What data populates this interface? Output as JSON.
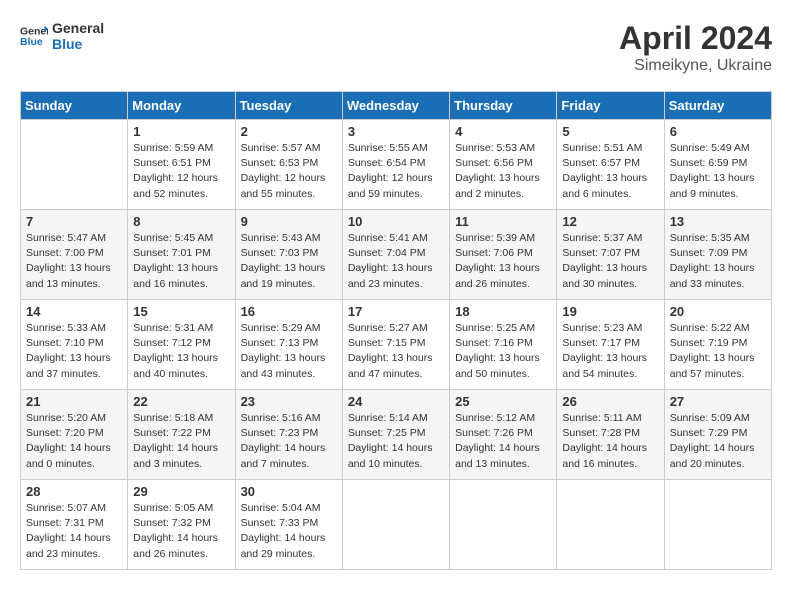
{
  "header": {
    "logo_general": "General",
    "logo_blue": "Blue",
    "month_title": "April 2024",
    "location": "Simeikyne, Ukraine"
  },
  "days_of_week": [
    "Sunday",
    "Monday",
    "Tuesday",
    "Wednesday",
    "Thursday",
    "Friday",
    "Saturday"
  ],
  "weeks": [
    [
      {
        "day": "",
        "info": ""
      },
      {
        "day": "1",
        "info": "Sunrise: 5:59 AM\nSunset: 6:51 PM\nDaylight: 12 hours\nand 52 minutes."
      },
      {
        "day": "2",
        "info": "Sunrise: 5:57 AM\nSunset: 6:53 PM\nDaylight: 12 hours\nand 55 minutes."
      },
      {
        "day": "3",
        "info": "Sunrise: 5:55 AM\nSunset: 6:54 PM\nDaylight: 12 hours\nand 59 minutes."
      },
      {
        "day": "4",
        "info": "Sunrise: 5:53 AM\nSunset: 6:56 PM\nDaylight: 13 hours\nand 2 minutes."
      },
      {
        "day": "5",
        "info": "Sunrise: 5:51 AM\nSunset: 6:57 PM\nDaylight: 13 hours\nand 6 minutes."
      },
      {
        "day": "6",
        "info": "Sunrise: 5:49 AM\nSunset: 6:59 PM\nDaylight: 13 hours\nand 9 minutes."
      }
    ],
    [
      {
        "day": "7",
        "info": "Sunrise: 5:47 AM\nSunset: 7:00 PM\nDaylight: 13 hours\nand 13 minutes."
      },
      {
        "day": "8",
        "info": "Sunrise: 5:45 AM\nSunset: 7:01 PM\nDaylight: 13 hours\nand 16 minutes."
      },
      {
        "day": "9",
        "info": "Sunrise: 5:43 AM\nSunset: 7:03 PM\nDaylight: 13 hours\nand 19 minutes."
      },
      {
        "day": "10",
        "info": "Sunrise: 5:41 AM\nSunset: 7:04 PM\nDaylight: 13 hours\nand 23 minutes."
      },
      {
        "day": "11",
        "info": "Sunrise: 5:39 AM\nSunset: 7:06 PM\nDaylight: 13 hours\nand 26 minutes."
      },
      {
        "day": "12",
        "info": "Sunrise: 5:37 AM\nSunset: 7:07 PM\nDaylight: 13 hours\nand 30 minutes."
      },
      {
        "day": "13",
        "info": "Sunrise: 5:35 AM\nSunset: 7:09 PM\nDaylight: 13 hours\nand 33 minutes."
      }
    ],
    [
      {
        "day": "14",
        "info": "Sunrise: 5:33 AM\nSunset: 7:10 PM\nDaylight: 13 hours\nand 37 minutes."
      },
      {
        "day": "15",
        "info": "Sunrise: 5:31 AM\nSunset: 7:12 PM\nDaylight: 13 hours\nand 40 minutes."
      },
      {
        "day": "16",
        "info": "Sunrise: 5:29 AM\nSunset: 7:13 PM\nDaylight: 13 hours\nand 43 minutes."
      },
      {
        "day": "17",
        "info": "Sunrise: 5:27 AM\nSunset: 7:15 PM\nDaylight: 13 hours\nand 47 minutes."
      },
      {
        "day": "18",
        "info": "Sunrise: 5:25 AM\nSunset: 7:16 PM\nDaylight: 13 hours\nand 50 minutes."
      },
      {
        "day": "19",
        "info": "Sunrise: 5:23 AM\nSunset: 7:17 PM\nDaylight: 13 hours\nand 54 minutes."
      },
      {
        "day": "20",
        "info": "Sunrise: 5:22 AM\nSunset: 7:19 PM\nDaylight: 13 hours\nand 57 minutes."
      }
    ],
    [
      {
        "day": "21",
        "info": "Sunrise: 5:20 AM\nSunset: 7:20 PM\nDaylight: 14 hours\nand 0 minutes."
      },
      {
        "day": "22",
        "info": "Sunrise: 5:18 AM\nSunset: 7:22 PM\nDaylight: 14 hours\nand 3 minutes."
      },
      {
        "day": "23",
        "info": "Sunrise: 5:16 AM\nSunset: 7:23 PM\nDaylight: 14 hours\nand 7 minutes."
      },
      {
        "day": "24",
        "info": "Sunrise: 5:14 AM\nSunset: 7:25 PM\nDaylight: 14 hours\nand 10 minutes."
      },
      {
        "day": "25",
        "info": "Sunrise: 5:12 AM\nSunset: 7:26 PM\nDaylight: 14 hours\nand 13 minutes."
      },
      {
        "day": "26",
        "info": "Sunrise: 5:11 AM\nSunset: 7:28 PM\nDaylight: 14 hours\nand 16 minutes."
      },
      {
        "day": "27",
        "info": "Sunrise: 5:09 AM\nSunset: 7:29 PM\nDaylight: 14 hours\nand 20 minutes."
      }
    ],
    [
      {
        "day": "28",
        "info": "Sunrise: 5:07 AM\nSunset: 7:31 PM\nDaylight: 14 hours\nand 23 minutes."
      },
      {
        "day": "29",
        "info": "Sunrise: 5:05 AM\nSunset: 7:32 PM\nDaylight: 14 hours\nand 26 minutes."
      },
      {
        "day": "30",
        "info": "Sunrise: 5:04 AM\nSunset: 7:33 PM\nDaylight: 14 hours\nand 29 minutes."
      },
      {
        "day": "",
        "info": ""
      },
      {
        "day": "",
        "info": ""
      },
      {
        "day": "",
        "info": ""
      },
      {
        "day": "",
        "info": ""
      }
    ]
  ]
}
